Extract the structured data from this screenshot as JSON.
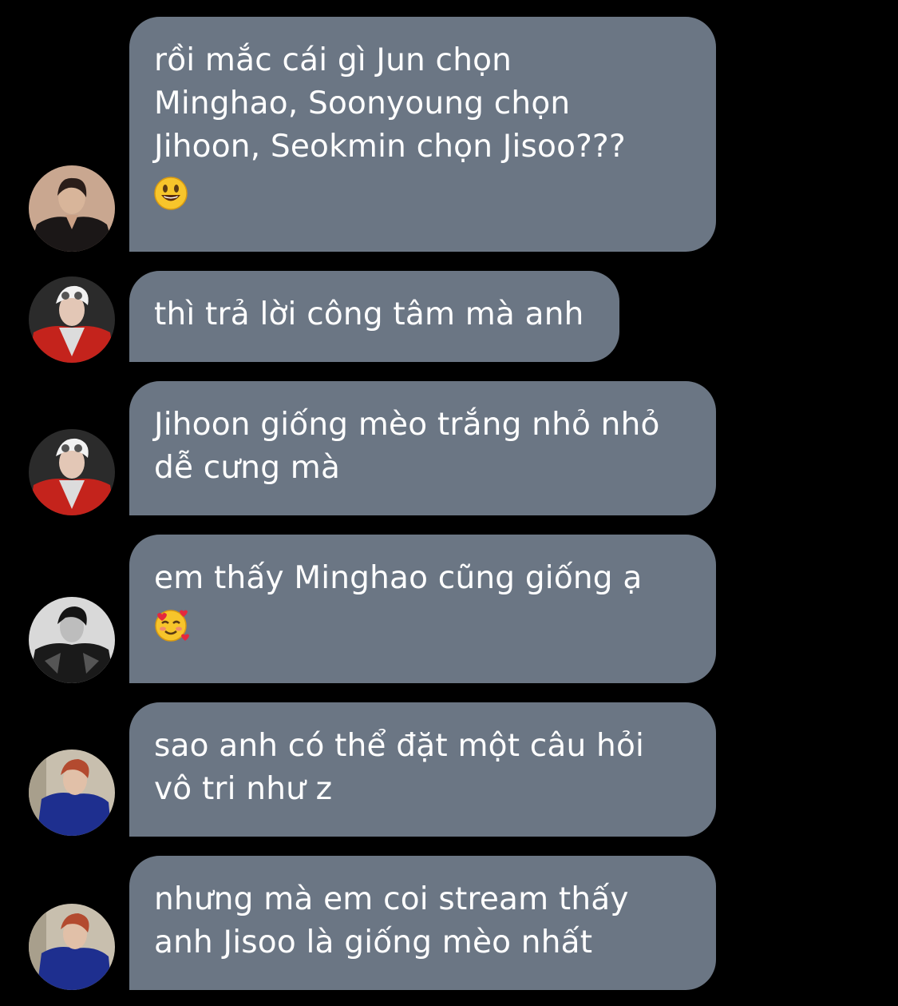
{
  "messages": [
    {
      "avatar": "avatar-man-black-suit",
      "lines": [
        "rồi mắc cái gì Jun chọn",
        "Minghao, Soonyoung chọn",
        "Jihoon, Seokmin chọn Jisoo???"
      ],
      "emoji": "smiley-face-emoji"
    },
    {
      "avatar": "avatar-white-hair-red-jacket",
      "lines": [
        "thì trả lời công tâm mà anh"
      ]
    },
    {
      "avatar": "avatar-white-hair-red-jacket",
      "lines": [
        "Jihoon giống mèo trắng nhỏ nhỏ",
        "dễ cưng mà"
      ]
    },
    {
      "avatar": "avatar-black-white-leather-jacket",
      "lines": [
        "em thấy Minghao cũng giống ạ"
      ],
      "emoji": "smiling-face-with-hearts-emoji"
    },
    {
      "avatar": "avatar-red-hair-blue-outfit",
      "lines": [
        "sao anh có thể đặt một câu hỏi",
        "vô tri như z"
      ]
    },
    {
      "avatar": "avatar-red-hair-blue-outfit",
      "lines": [
        "nhưng mà em coi stream thấy",
        "anh Jisoo là giống mèo nhất"
      ]
    }
  ],
  "colors": {
    "background": "#000000",
    "bubble": "#6b7684",
    "text": "#ffffff"
  }
}
